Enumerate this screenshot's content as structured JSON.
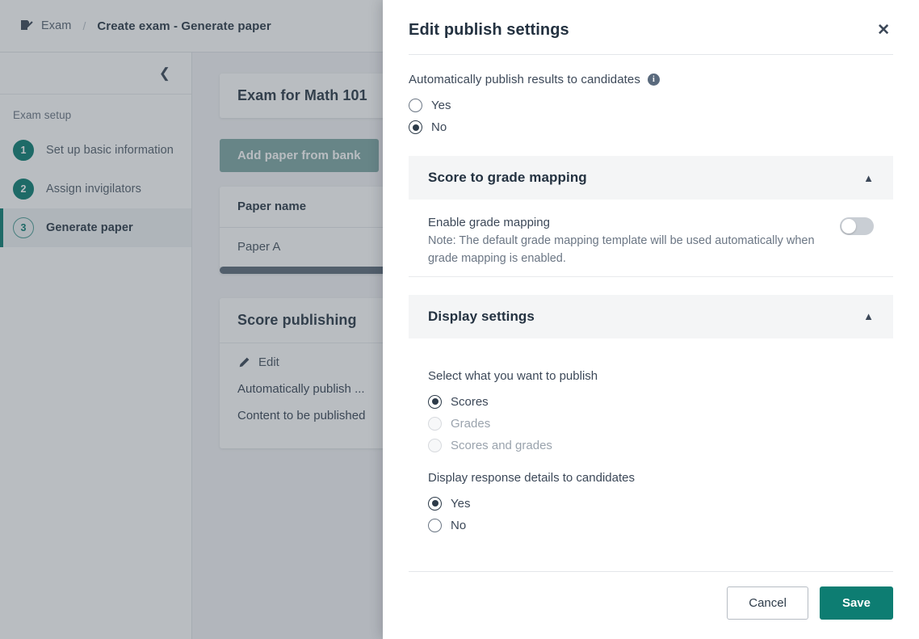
{
  "breadcrumb": {
    "icon": "exam-document-icon",
    "root": "Exam",
    "separator": "/",
    "current": "Create exam - Generate paper"
  },
  "sidebar": {
    "collapse_icon": "chevron-left-icon",
    "section_title": "Exam setup",
    "steps": [
      {
        "number": "1",
        "label": "Set up basic information",
        "state": "done"
      },
      {
        "number": "2",
        "label": "Assign invigilators",
        "state": "done"
      },
      {
        "number": "3",
        "label": "Generate paper",
        "state": "current"
      }
    ]
  },
  "main": {
    "exam_card_title": "Exam for Math 101",
    "add_paper_button": "Add paper from bank",
    "add_plus_icon": "plus-icon",
    "paper_table": {
      "columns": [
        "Paper name"
      ],
      "rows": [
        [
          "Paper A"
        ]
      ]
    },
    "score_publishing": {
      "title": "Score publishing",
      "edit_icon": "pencil-icon",
      "edit_label": "Edit",
      "lines": [
        "Automatically publish ...",
        "Content to be published"
      ]
    }
  },
  "panel": {
    "title": "Edit publish settings",
    "close_icon": "close-icon",
    "auto_publish": {
      "label": "Automatically publish results to candidates",
      "info_icon": "info-icon",
      "options": [
        {
          "label": "Yes",
          "selected": false,
          "disabled": false
        },
        {
          "label": "No",
          "selected": true,
          "disabled": false
        }
      ]
    },
    "score_to_grade_mapping": {
      "title": "Score to grade mapping",
      "chevron_icon": "chevron-up-icon",
      "enable_label": "Enable grade mapping",
      "enable_state": "off",
      "note": "Note: The default grade mapping template will be used automatically when grade mapping is enabled."
    },
    "display_settings": {
      "title": "Display settings",
      "chevron_icon": "chevron-up-icon",
      "publish_select_label": "Select what you want to publish",
      "publish_options": [
        {
          "label": "Scores",
          "selected": true,
          "disabled": false
        },
        {
          "label": "Grades",
          "selected": false,
          "disabled": true
        },
        {
          "label": "Scores and grades",
          "selected": false,
          "disabled": true
        }
      ],
      "response_details_label": "Display response details to candidates",
      "response_details_options": [
        {
          "label": "Yes",
          "selected": true,
          "disabled": false
        },
        {
          "label": "No",
          "selected": false,
          "disabled": false
        }
      ]
    },
    "footer": {
      "cancel_label": "Cancel",
      "save_label": "Save"
    }
  },
  "colors": {
    "accent_teal": "#0d7d72",
    "accent_teal_soft": "#7fa8a4",
    "text_dark": "#243241",
    "text_body": "#3c4858",
    "text_muted": "#6b7684",
    "panel_section_bg": "#f4f5f6",
    "overlay": "rgba(61,72,84,0.36)"
  }
}
